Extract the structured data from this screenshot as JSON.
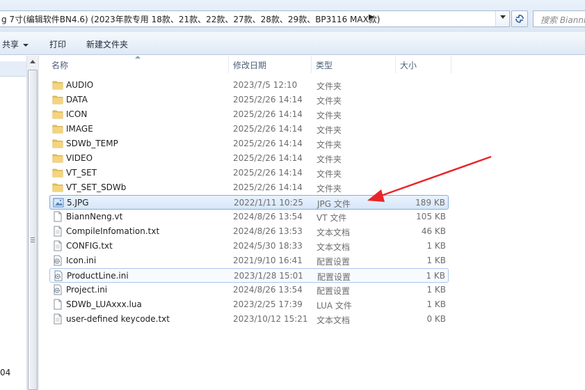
{
  "address": {
    "path_text": "g 7寸(编辑软件BN4.6) (2023年款专用 18款、21款、22款、27款、28款、29款、BP3116 MAX款)",
    "path_arrow": "▶"
  },
  "search": {
    "placeholder": "搜索 Biannl"
  },
  "toolbar": {
    "share_label": "共享",
    "print_label": "打印",
    "new_folder_label": "新建文件夹"
  },
  "nav": {
    "bottom_text": "04"
  },
  "columns": {
    "name": "名称",
    "date": "修改日期",
    "type": "类型",
    "size": "大小"
  },
  "files": [
    {
      "name": "AUDIO",
      "date": "2023/7/5 12:10",
      "type": "文件夹",
      "size": "",
      "icon": "folder-icon"
    },
    {
      "name": "DATA",
      "date": "2025/2/26 14:14",
      "type": "文件夹",
      "size": "",
      "icon": "folder-icon"
    },
    {
      "name": "ICON",
      "date": "2025/2/26 14:14",
      "type": "文件夹",
      "size": "",
      "icon": "folder-icon"
    },
    {
      "name": "IMAGE",
      "date": "2025/2/26 14:14",
      "type": "文件夹",
      "size": "",
      "icon": "folder-icon"
    },
    {
      "name": "SDWb_TEMP",
      "date": "2025/2/26 14:14",
      "type": "文件夹",
      "size": "",
      "icon": "folder-icon"
    },
    {
      "name": "VIDEO",
      "date": "2025/2/26 14:14",
      "type": "文件夹",
      "size": "",
      "icon": "folder-icon"
    },
    {
      "name": "VT_SET",
      "date": "2025/2/26 14:14",
      "type": "文件夹",
      "size": "",
      "icon": "folder-icon"
    },
    {
      "name": "VT_SET_SDWb",
      "date": "2025/2/26 14:14",
      "type": "文件夹",
      "size": "",
      "icon": "folder-icon"
    },
    {
      "name": "5.JPG",
      "date": "2022/1/11 10:25",
      "type": "JPG 文件",
      "size": "189 KB",
      "icon": "image-file-icon"
    },
    {
      "name": "BiannNeng.vt",
      "date": "2024/8/26 13:54",
      "type": "VT 文件",
      "size": "105 KB",
      "icon": "file-icon"
    },
    {
      "name": "CompileInfomation.txt",
      "date": "2024/8/26 13:53",
      "type": "文本文档",
      "size": "46 KB",
      "icon": "text-file-icon"
    },
    {
      "name": "CONFIG.txt",
      "date": "2024/5/30 18:33",
      "type": "文本文档",
      "size": "1 KB",
      "icon": "text-file-icon"
    },
    {
      "name": "Icon.ini",
      "date": "2021/9/10 16:41",
      "type": "配置设置",
      "size": "1 KB",
      "icon": "settings-file-icon"
    },
    {
      "name": "ProductLine.ini",
      "date": "2023/1/28 15:01",
      "type": "配置设置",
      "size": "1 KB",
      "icon": "settings-file-icon"
    },
    {
      "name": "Project.ini",
      "date": "2024/8/26 13:54",
      "type": "配置设置",
      "size": "1 KB",
      "icon": "settings-file-icon"
    },
    {
      "name": "SDWb_LUAxxx.lua",
      "date": "2023/2/25 17:39",
      "type": "LUA 文件",
      "size": "1 KB",
      "icon": "file-icon"
    },
    {
      "name": "user-defined keycode.txt",
      "date": "2023/10/12 15:21",
      "type": "文本文档",
      "size": "0 KB",
      "icon": "text-file-icon"
    }
  ],
  "selected_file": "5.JPG",
  "hovered_file": "ProductLine.ini",
  "colors": {
    "annotation_arrow": "#e8262a",
    "selection_border": "#84acdd",
    "folder": "#e8c05a"
  }
}
